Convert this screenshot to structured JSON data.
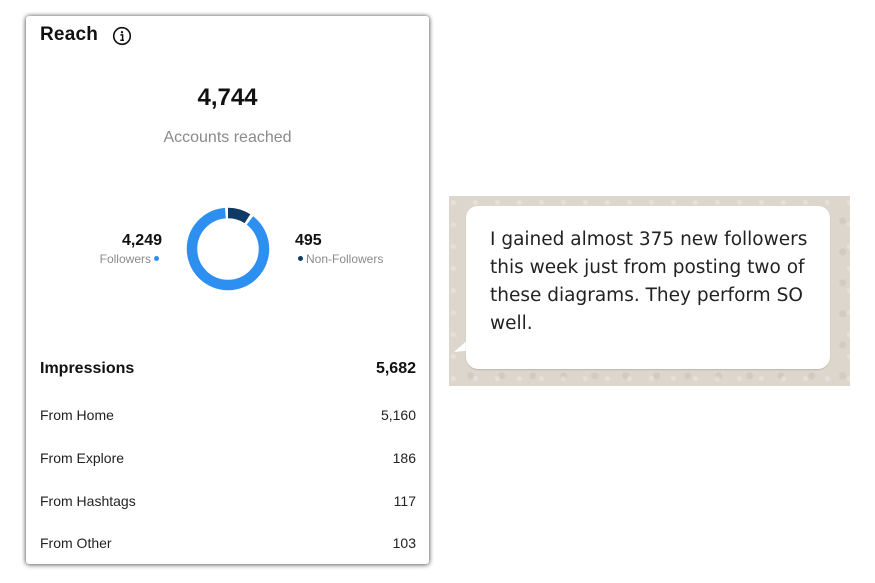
{
  "reach": {
    "title": "Reach",
    "info_icon": "info-icon",
    "accounts_reached": {
      "value": "4,744",
      "label": "Accounts reached"
    },
    "followers": {
      "value": "4,249",
      "label": "Followers",
      "color": "#2d8ff0",
      "fraction": 0.896
    },
    "non_followers": {
      "value": "495",
      "label": "Non-Followers",
      "color": "#0f3a66",
      "fraction": 0.104
    },
    "impressions": {
      "label": "Impressions",
      "value": "5,682",
      "rows": [
        {
          "label": "From Home",
          "value": "5,160"
        },
        {
          "label": "From Explore",
          "value": "186"
        },
        {
          "label": "From Hashtags",
          "value": "117"
        },
        {
          "label": "From Other",
          "value": "103"
        }
      ]
    }
  },
  "message": {
    "text": "I gained almost 375 new followers this week just from posting two of these diagrams. They perform SO well."
  }
}
